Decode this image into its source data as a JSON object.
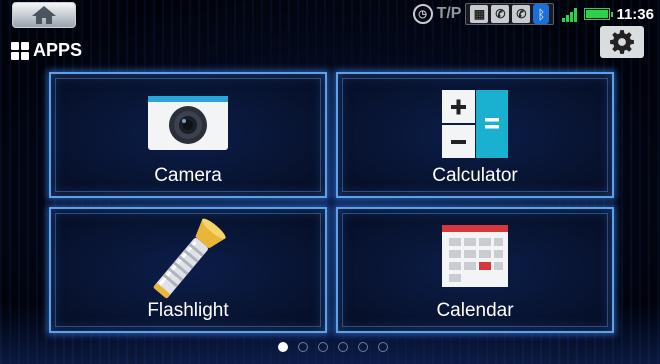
{
  "status_bar": {
    "home_icon": "home-icon",
    "tp_label": "T/P",
    "time": "11:36",
    "battery_level": 1.0,
    "signal_bars": 4
  },
  "header": {
    "title": "APPS",
    "apps_icon": "apps-grid-icon",
    "settings_icon": "gear-icon"
  },
  "apps": [
    {
      "label": "Camera",
      "icon": "camera-icon"
    },
    {
      "label": "Calculator",
      "icon": "calculator-icon"
    },
    {
      "label": "Flashlight",
      "icon": "flashlight-icon"
    },
    {
      "label": "Calendar",
      "icon": "calendar-icon"
    }
  ],
  "pager": {
    "pages": 6,
    "active": 1
  },
  "colors": {
    "accent": "#5fa0e8",
    "signal": "#2fd14b",
    "bluetooth": "#1d6fd8"
  }
}
